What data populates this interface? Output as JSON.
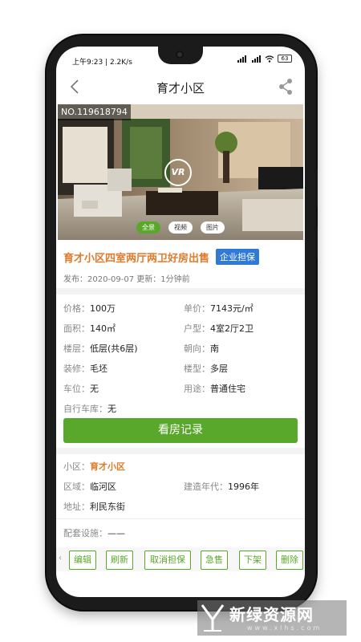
{
  "status": {
    "time": "上午9:23 | 2.2K/s",
    "battery": "63"
  },
  "nav": {
    "title": "育才小区"
  },
  "hero": {
    "listing_no": "NO.119618794",
    "vr": "VR",
    "tabs": [
      {
        "label": "全景"
      },
      {
        "label": "视频"
      },
      {
        "label": "图片"
      }
    ]
  },
  "listing": {
    "title": "育才小区四室两厅两卫好房出售",
    "badge": "企业担保",
    "publish": "发布：2020-09-07 更新：1分钟前"
  },
  "details": [
    {
      "key": "价格：",
      "value": "100万"
    },
    {
      "key": "单价：",
      "value": "7143元/㎡"
    },
    {
      "key": "面积：",
      "value": "140㎡"
    },
    {
      "key": "户型：",
      "value": "4室2厅2卫"
    },
    {
      "key": "楼层：",
      "value": "低层(共6层)"
    },
    {
      "key": "朝向：",
      "value": "南"
    },
    {
      "key": "装修：",
      "value": "毛坯"
    },
    {
      "key": "楼型：",
      "value": "多层"
    },
    {
      "key": "车位：",
      "value": "无"
    },
    {
      "key": "用途：",
      "value": "普通住宅"
    },
    {
      "key": "自行车库：",
      "value": "无"
    }
  ],
  "record_button": "看房记录",
  "community": {
    "name_key": "小区：",
    "name_value": "育才小区",
    "district_key": "区域：",
    "district_value": "临河区",
    "year_key": "建造年代：",
    "year_value": "1996年",
    "address_key": "地址：",
    "address_value": "利民东街",
    "facilities_key": "配套设施：",
    "facilities_value": "——"
  },
  "actions": [
    {
      "label": "编辑"
    },
    {
      "label": "刷新"
    },
    {
      "label": "取消担保"
    },
    {
      "label": "急售"
    },
    {
      "label": "下架"
    },
    {
      "label": "删除"
    }
  ],
  "watermark": {
    "text": "新绿资源网",
    "url": "www.xlhs.com"
  },
  "colors": {
    "accent_green": "#5aa82b",
    "title_orange": "#e07a2a",
    "badge_blue": "#2f7ad6"
  }
}
